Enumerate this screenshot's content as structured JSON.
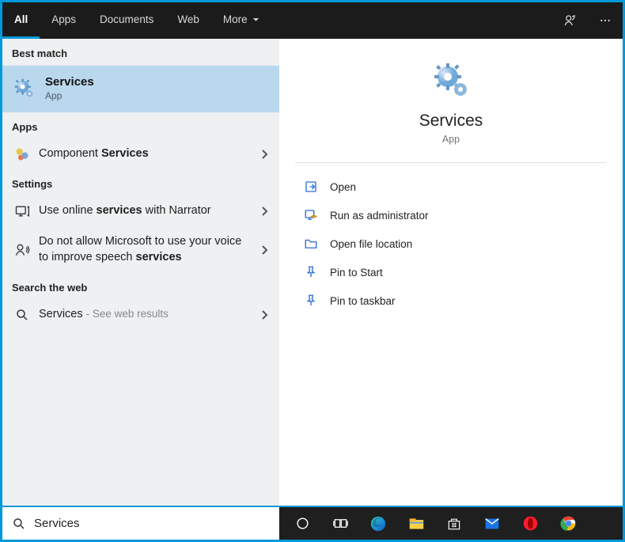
{
  "tabs": [
    "All",
    "Apps",
    "Documents",
    "Web",
    "More"
  ],
  "left": {
    "sections": {
      "best_match": "Best match",
      "apps": "Apps",
      "settings": "Settings",
      "web": "Search the web"
    },
    "best": {
      "title": "Services",
      "subtitle": "App"
    },
    "apps": [
      {
        "pre": "Component",
        "bold": "Services"
      }
    ],
    "settings": [
      {
        "pre": "Use online",
        "bold": "services",
        "post": "with Narrator"
      },
      {
        "pre": "Do not allow Microsoft to use your voice to improve speech",
        "bold": "services"
      }
    ],
    "web": [
      {
        "query": "Services",
        "hint": "- See web results"
      }
    ]
  },
  "right": {
    "title": "Services",
    "subtitle": "App",
    "actions": [
      "Open",
      "Run as administrator",
      "Open file location",
      "Pin to Start",
      "Pin to taskbar"
    ]
  },
  "search": {
    "value": "Services"
  }
}
